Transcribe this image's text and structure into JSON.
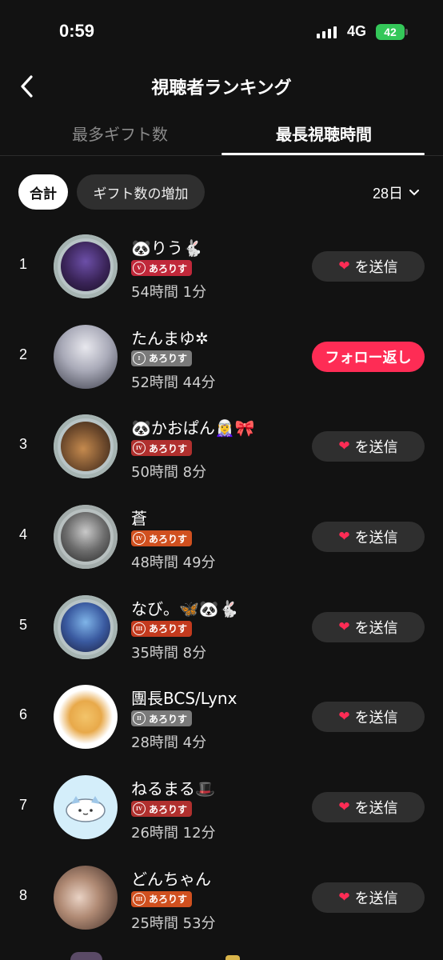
{
  "status": {
    "time": "0:59",
    "network": "4G",
    "battery": "42"
  },
  "header": {
    "title": "視聴者ランキング"
  },
  "tabs": [
    {
      "label": "最多ギフト数",
      "active": false
    },
    {
      "label": "最長視聴時間",
      "active": true
    }
  ],
  "filters": {
    "total": "合計",
    "gift_increase": "ギフト数の増加",
    "period": "28日"
  },
  "colors": {
    "accent": "#fe2c55",
    "chip_bg": "#2f2f2f",
    "background": "#121212"
  },
  "viewers": [
    {
      "rank": "1",
      "name": "🐼りう🐇",
      "badge": "あろりす",
      "badge_level": "V",
      "duration": "54時間 1分",
      "action": "を送信",
      "action_icon": "heart-icon"
    },
    {
      "rank": "2",
      "name": "たんまゆ✲",
      "badge": "あろりす",
      "badge_level": "I",
      "duration": "52時間 44分",
      "action": "フォロー返し",
      "action_icon": ""
    },
    {
      "rank": "3",
      "name": "🐼かおぱん🧝‍♀️🎀",
      "badge": "あろりす",
      "badge_level": "IV",
      "duration": "50時間 8分",
      "action": "を送信",
      "action_icon": "heart-icon"
    },
    {
      "rank": "4",
      "name": "蒼",
      "badge": "あろりす",
      "badge_level": "IV",
      "duration": "48時間 49分",
      "action": "を送信",
      "action_icon": "heart-icon"
    },
    {
      "rank": "5",
      "name": "なび。🦋🐼🐇",
      "badge": "あろりす",
      "badge_level": "III",
      "duration": "35時間 8分",
      "action": "を送信",
      "action_icon": "heart-icon"
    },
    {
      "rank": "6",
      "name": "團長BCS/Lynx",
      "badge": "あろりす",
      "badge_level": "II",
      "duration": "28時間 4分",
      "action": "を送信",
      "action_icon": "heart-icon"
    },
    {
      "rank": "7",
      "name": "ねるまる🎩",
      "badge": "あろりす",
      "badge_level": "IV",
      "duration": "26時間 12分",
      "action": "を送信",
      "action_icon": "heart-icon"
    },
    {
      "rank": "8",
      "name": "どんちゃん",
      "badge": "あろりす",
      "badge_level": "III",
      "duration": "25時間 53分",
      "action": "を送信",
      "action_icon": "heart-icon"
    }
  ]
}
